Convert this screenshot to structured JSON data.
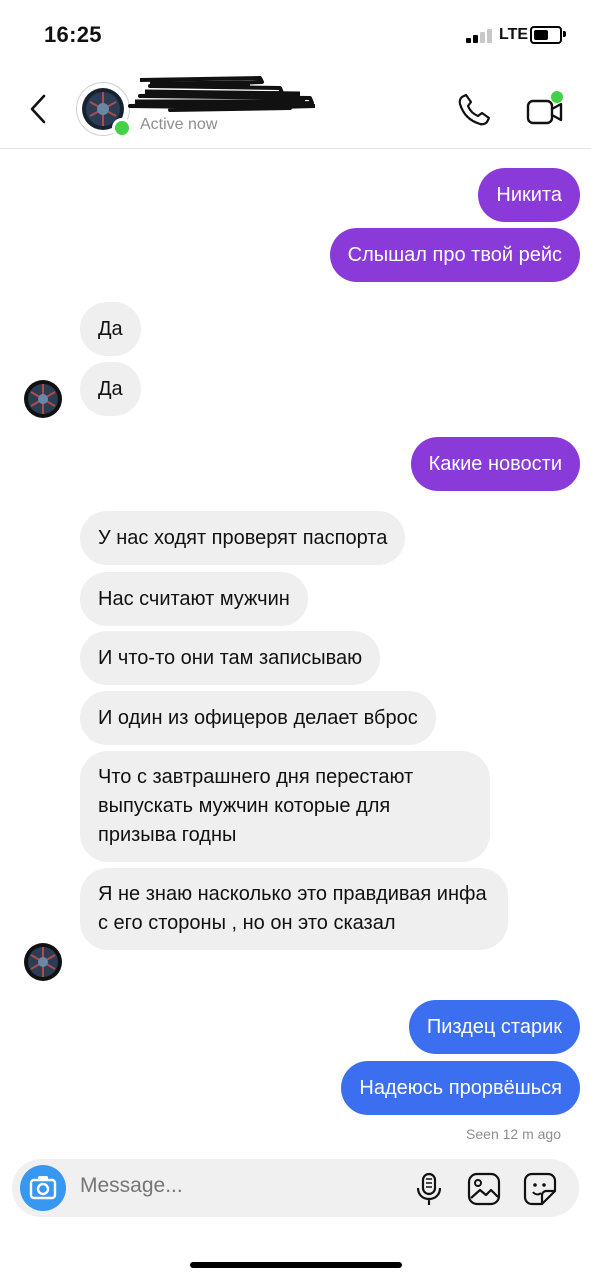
{
  "status_bar": {
    "time": "16:25",
    "network": "LTE",
    "battery_level": 0.6
  },
  "header": {
    "status": "Active now"
  },
  "messages": [
    {
      "text": "Никита",
      "from": "me"
    },
    {
      "text": "Слышал про твой рейс",
      "from": "me"
    },
    {
      "text": "Да",
      "from": "contact"
    },
    {
      "text": "Да",
      "from": "contact"
    },
    {
      "text": "Какие новости",
      "from": "me"
    },
    {
      "text": "У нас ходят проверят паспорта",
      "from": "contact"
    },
    {
      "text": "Нас считают мужчин",
      "from": "contact"
    },
    {
      "text": "И что-то они там записываю",
      "from": "contact"
    },
    {
      "text": "И один из офицеров делает вброс",
      "from": "contact"
    },
    {
      "text": "Что с завтрашнего дня перестают выпускать мужчин которые для призыва годны",
      "from": "contact"
    },
    {
      "text": "Я не знаю насколько это правдивая инфа с его стороны , но он это сказал",
      "from": "contact"
    },
    {
      "text": "Пиздец старик",
      "from": "me"
    },
    {
      "text": "Надеюсь прорвёшься",
      "from": "me"
    }
  ],
  "seen_text": "Seen 12 m ago",
  "composer": {
    "placeholder": "Message..."
  },
  "icons": {
    "back": "chevron-left-icon",
    "call": "phone-icon",
    "video": "video-camera-icon",
    "camera": "camera-icon",
    "mic": "microphone-icon",
    "gallery": "image-icon",
    "sticker": "sticker-icon"
  },
  "colors": {
    "purple_bubble": "#8a3ad8",
    "blue_bubble": "#3b6ff0",
    "incoming_bubble": "#efefef",
    "online": "#44d047",
    "camera_button": "#3897f0"
  }
}
